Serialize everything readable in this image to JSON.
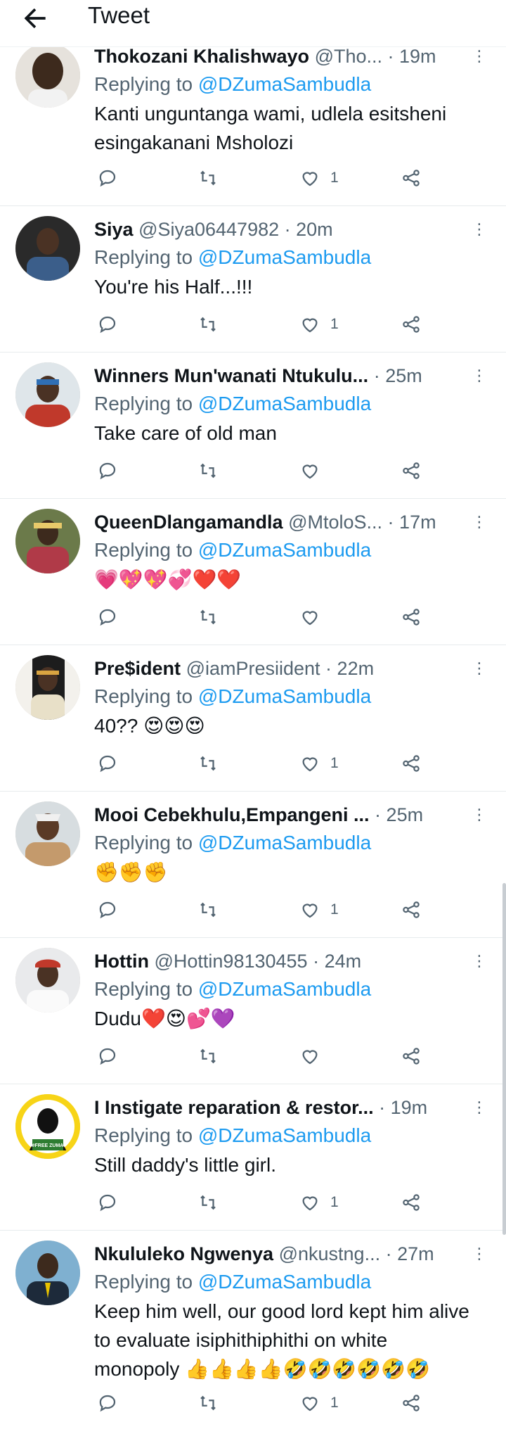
{
  "header": {
    "title": "Tweet"
  },
  "tweets": [
    {
      "name": "Thokozani Khalishwayo",
      "handle": "@Tho...",
      "sep": " · ",
      "time": "19m",
      "replying_prefix": "Replying to ",
      "replying_handle": "@DZumaSambudla",
      "text": "Kanti unguntanga wami, udlela esitsheni esingakanani Msholozi",
      "likes": "1"
    },
    {
      "name": "Siya",
      "handle": "@Siya06447982",
      "sep": " · ",
      "time": "20m",
      "replying_prefix": "Replying to ",
      "replying_handle": "@DZumaSambudla",
      "text": "You're his Half...!!!",
      "likes": "1"
    },
    {
      "name": "Winners Mun'wanati Ntukulu...",
      "handle": "",
      "sep": " · ",
      "time": "25m",
      "replying_prefix": "Replying to ",
      "replying_handle": "@DZumaSambudla",
      "text": "Take care of old man",
      "likes": ""
    },
    {
      "name": "QueenDlangamandla",
      "handle": "@MtoloS...",
      "sep": " · ",
      "time": "17m",
      "replying_prefix": "Replying to ",
      "replying_handle": "@DZumaSambudla",
      "text": "💗💖💖💞❤️❤️",
      "likes": ""
    },
    {
      "name": "Pre$ident",
      "handle": "@iamPresiident",
      "sep": " · ",
      "time": "22m",
      "replying_prefix": "Replying to ",
      "replying_handle": "@DZumaSambudla",
      "text": "40?? 😍😍😍",
      "likes": "1"
    },
    {
      "name": "Mooi Cebekhulu,Empangeni ...",
      "handle": "",
      "sep": " · ",
      "time": "25m",
      "replying_prefix": "Replying to ",
      "replying_handle": "@DZumaSambudla",
      "text": "✊✊✊",
      "likes": "1"
    },
    {
      "name": "Hottin",
      "handle": "@Hottin98130455",
      "sep": " · ",
      "time": "24m",
      "replying_prefix": "Replying to ",
      "replying_handle": "@DZumaSambudla",
      "text": "Dudu❤️😍💕💜",
      "likes": ""
    },
    {
      "name": "I Instigate reparation & restor...",
      "handle": "",
      "sep": " · ",
      "time": "19m",
      "replying_prefix": "Replying to ",
      "replying_handle": "@DZumaSambudla",
      "text": "Still daddy's little girl.",
      "likes": "1"
    },
    {
      "name": "Nkululeko Ngwenya",
      "handle": "@nkustng...",
      "sep": " · ",
      "time": "27m",
      "replying_prefix": "Replying to ",
      "replying_handle": "@DZumaSambudla",
      "text": "Keep him well, our good lord kept him alive to evaluate isiphithiphithi on white monopoly 👍👍👍👍🤣🤣🤣🤣🤣🤣",
      "likes": "1"
    }
  ],
  "avatar_badge": "#FREE ZUMA",
  "icons": {
    "back": "arrow-left-icon",
    "more": "more-vertical-icon",
    "reply": "reply-icon",
    "retweet": "retweet-icon",
    "like": "heart-icon",
    "share": "share-icon"
  },
  "colors": {
    "link": "#1d9bf0",
    "muted": "#536471",
    "divider": "#e7ebed"
  }
}
